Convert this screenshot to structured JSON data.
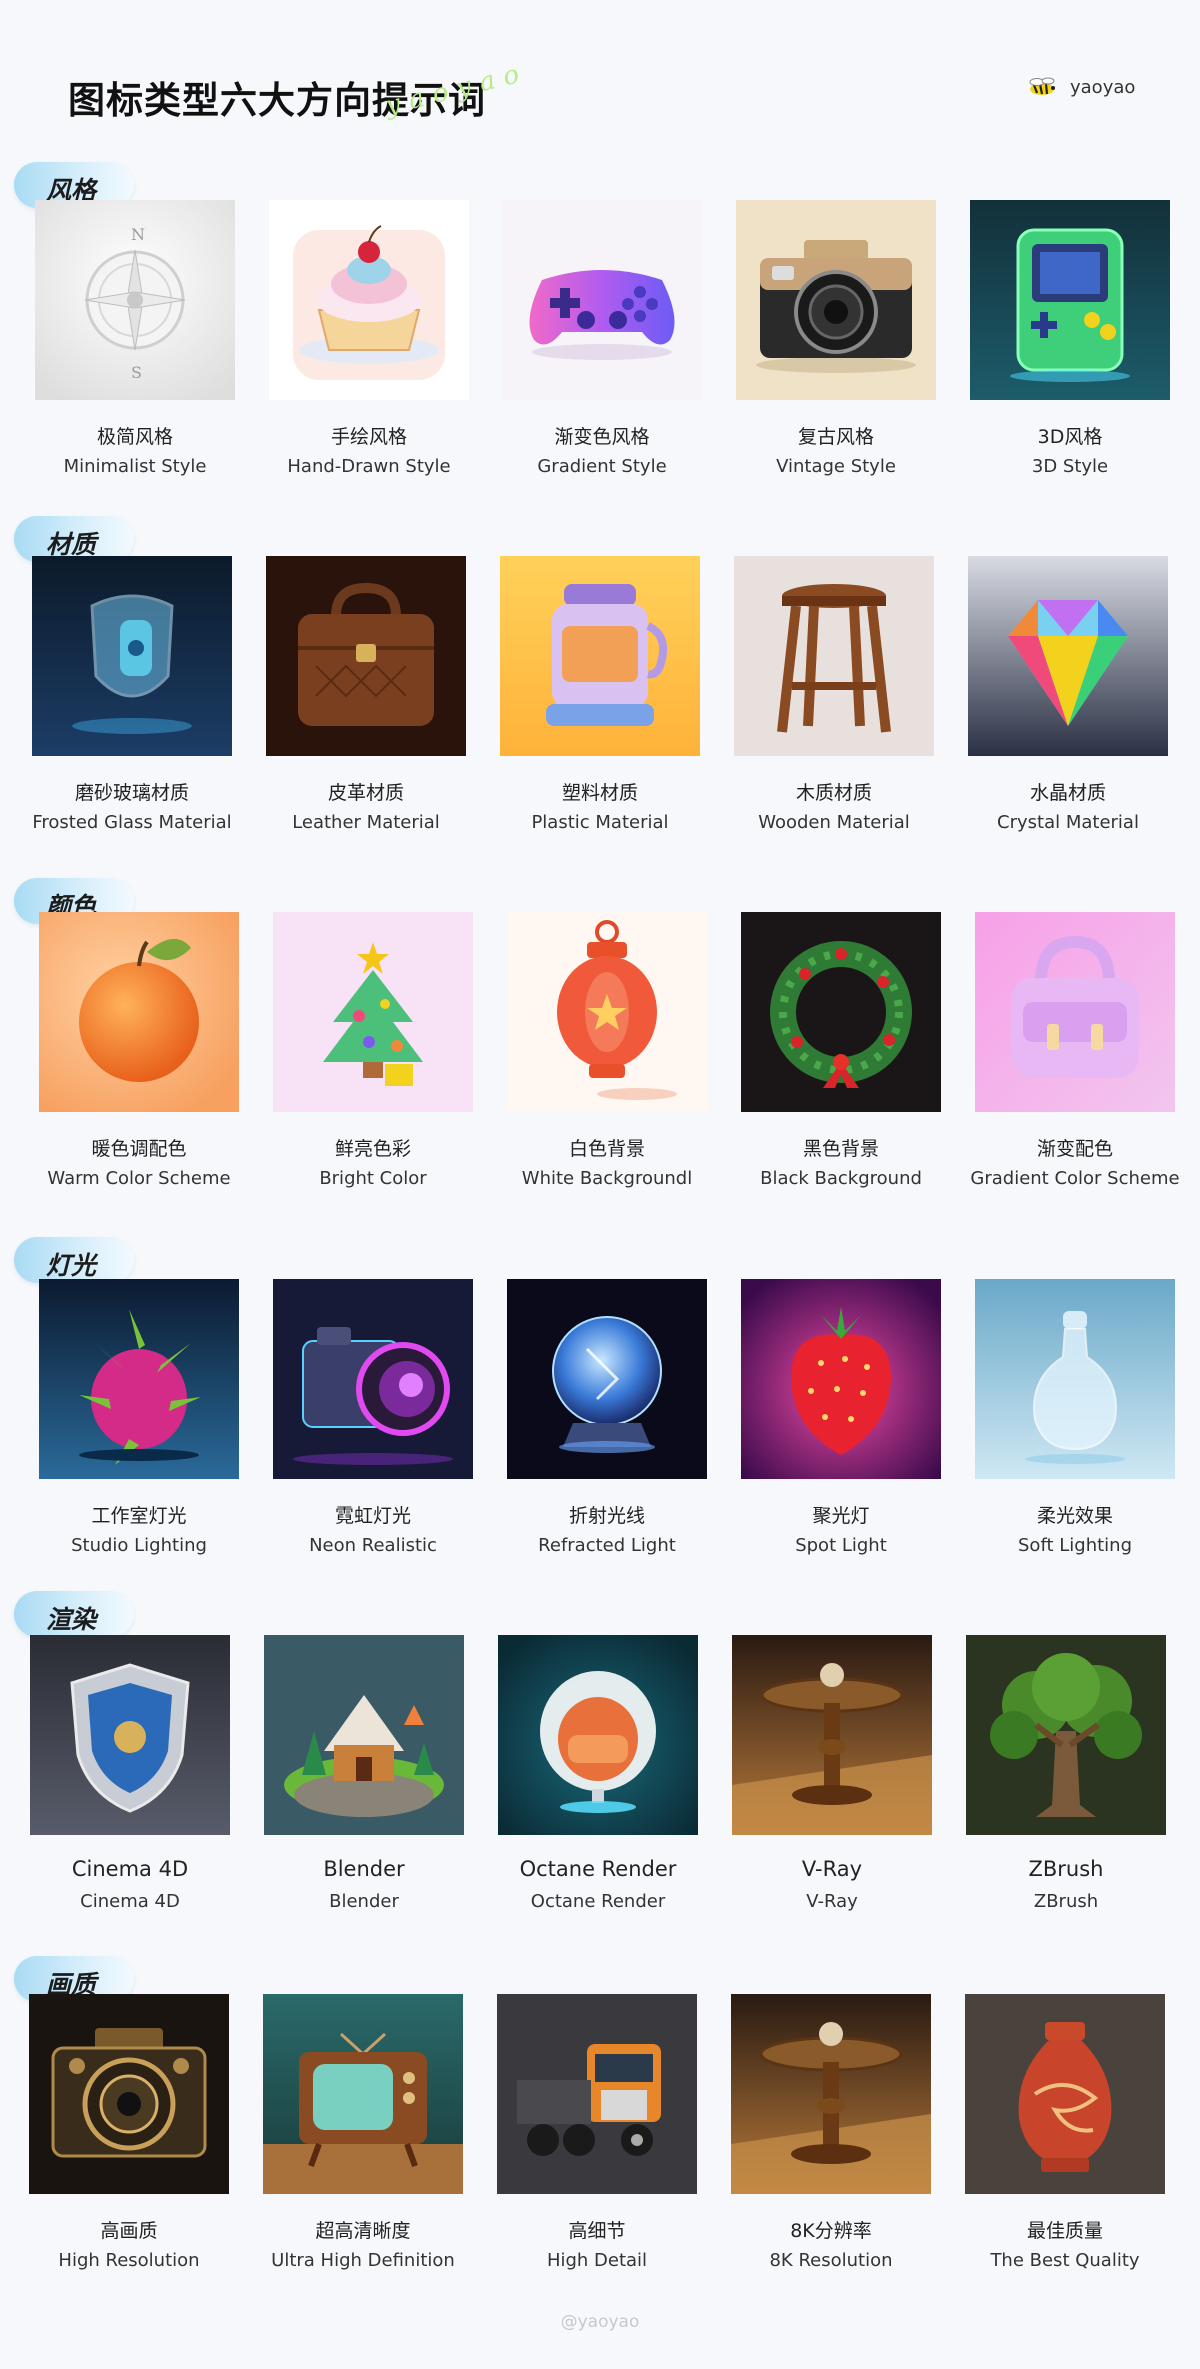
{
  "header": {
    "title": "图标类型六大方向提示词",
    "script_text": "yaoyao",
    "brand_name": "yaoyao",
    "logo_icon": "bee-icon"
  },
  "sections": [
    {
      "tag": "风格",
      "items": [
        {
          "cn": "极简风格",
          "en": "Minimalist Style",
          "icon": "compass-icon"
        },
        {
          "cn": "手绘风格",
          "en": "Hand-Drawn Style",
          "icon": "cupcake-icon"
        },
        {
          "cn": "渐变色风格",
          "en": "Gradient Style",
          "icon": "gamepad-icon"
        },
        {
          "cn": "复古风格",
          "en": "Vintage Style",
          "icon": "retro-camera-icon"
        },
        {
          "cn": "3D风格",
          "en": "3D Style",
          "icon": "handheld-console-icon"
        }
      ]
    },
    {
      "tag": "材质",
      "items": [
        {
          "cn": "磨砂玻璃材质",
          "en": "Frosted Glass Material",
          "icon": "glass-shield-icon"
        },
        {
          "cn": "皮革材质",
          "en": "Leather Material",
          "icon": "leather-bag-icon"
        },
        {
          "cn": "塑料材质",
          "en": "Plastic Material",
          "icon": "plastic-blender-icon"
        },
        {
          "cn": "木质材质",
          "en": "Wooden Material",
          "icon": "wooden-stool-icon"
        },
        {
          "cn": "水晶材质",
          "en": "Crystal Material",
          "icon": "crystal-gem-icon"
        }
      ]
    },
    {
      "tag": "颜色",
      "items": [
        {
          "cn": "暖色调配色",
          "en": "Warm Color Scheme",
          "icon": "apple-icon"
        },
        {
          "cn": "鲜亮色彩",
          "en": "Bright Color",
          "icon": "christmas-tree-icon"
        },
        {
          "cn": "白色背景",
          "en": "White Backgroundl",
          "icon": "lantern-icon"
        },
        {
          "cn": "黑色背景",
          "en": "Black Background",
          "icon": "wreath-icon"
        },
        {
          "cn": "渐变配色",
          "en": "Gradient Color Scheme",
          "icon": "handbag-icon"
        }
      ]
    },
    {
      "tag": "灯光",
      "items": [
        {
          "cn": "工作室灯光",
          "en": "Studio Lighting",
          "icon": "dragon-fruit-icon"
        },
        {
          "cn": "霓虹灯光",
          "en": "Neon Realistic",
          "icon": "neon-camera-icon"
        },
        {
          "cn": "折射光线",
          "en": "Refracted Light",
          "icon": "crystal-ball-icon"
        },
        {
          "cn": "聚光灯",
          "en": "Spot Light",
          "icon": "strawberry-icon"
        },
        {
          "cn": "柔光效果",
          "en": "Soft Lighting",
          "icon": "glass-bottle-icon"
        }
      ]
    },
    {
      "tag": "渲染",
      "items": [
        {
          "cn": "Cinema 4D",
          "en": "Cinema 4D",
          "icon": "metal-shield-icon"
        },
        {
          "cn": "Blender",
          "en": "Blender",
          "icon": "cottage-island-icon"
        },
        {
          "cn": "Octane Render",
          "en": "Octane Render",
          "icon": "egg-chair-icon"
        },
        {
          "cn": "V-Ray",
          "en": "V-Ray",
          "icon": "wooden-table-icon"
        },
        {
          "cn": "ZBrush",
          "en": "ZBrush",
          "icon": "tree-icon"
        }
      ]
    },
    {
      "tag": "画质",
      "items": [
        {
          "cn": "高画质",
          "en": "High Resolution",
          "icon": "vintage-camera-icon"
        },
        {
          "cn": "超高清晰度",
          "en": "Ultra High Definition",
          "icon": "retro-tv-icon"
        },
        {
          "cn": "高细节",
          "en": "High Detail",
          "icon": "truck-icon"
        },
        {
          "cn": "8K分辨率",
          "en": "8K Resolution",
          "icon": "wooden-table-icon"
        },
        {
          "cn": "最佳质量",
          "en": "The Best Quality",
          "icon": "dragon-vase-icon"
        }
      ]
    }
  ],
  "footer": {
    "handle": "@yaoyao"
  }
}
